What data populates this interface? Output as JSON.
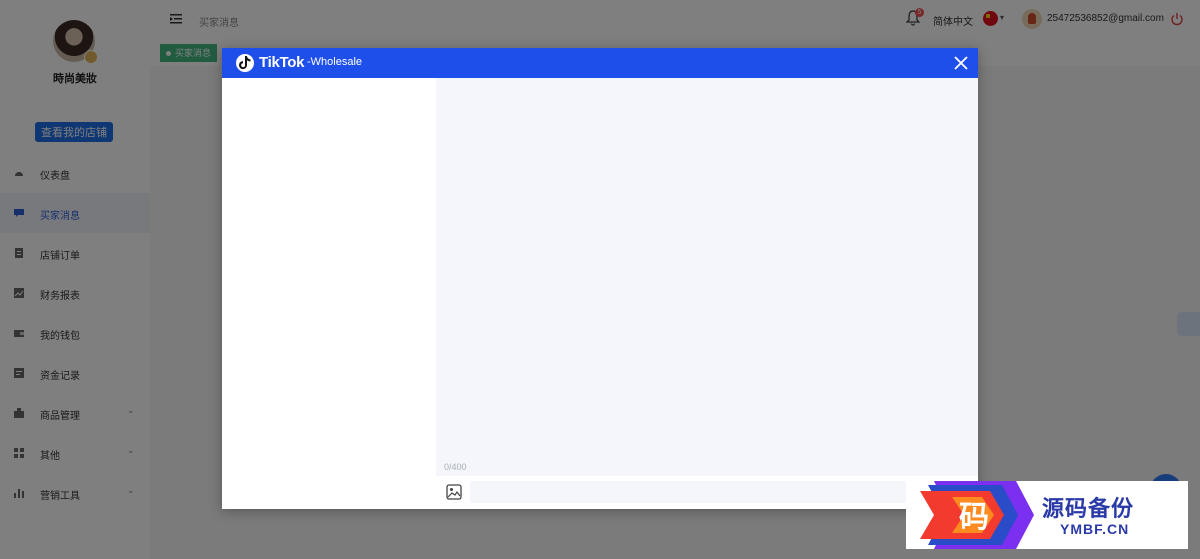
{
  "sidebar": {
    "shop_name": "時尚美妝",
    "view_store_label": "查看我的店铺",
    "items": [
      {
        "label": "仪表盘",
        "icon": "dashboard-icon",
        "active": false,
        "expandable": false
      },
      {
        "label": "买家消息",
        "icon": "message-icon",
        "active": true,
        "expandable": false
      },
      {
        "label": "店铺订单",
        "icon": "order-icon",
        "active": false,
        "expandable": false
      },
      {
        "label": "财务报表",
        "icon": "report-icon",
        "active": false,
        "expandable": false
      },
      {
        "label": "我的钱包",
        "icon": "wallet-icon",
        "active": false,
        "expandable": false
      },
      {
        "label": "资金记录",
        "icon": "record-icon",
        "active": false,
        "expandable": false
      },
      {
        "label": "商品管理",
        "icon": "goods-icon",
        "active": false,
        "expandable": true
      },
      {
        "label": "其他",
        "icon": "grid-icon",
        "active": false,
        "expandable": true
      },
      {
        "label": "营销工具",
        "icon": "chart-icon",
        "active": false,
        "expandable": true
      }
    ]
  },
  "header": {
    "breadcrumb": "买家消息",
    "notification_count": "5",
    "language": "简体中文",
    "email": "25472536852@gmail.com"
  },
  "tabs": [
    {
      "label": "买家消息",
      "active": true
    }
  ],
  "modal": {
    "brand": "TikTok",
    "suffix": "-Wholesale",
    "char_count": "0/400",
    "message_placeholder": ""
  },
  "watermark": {
    "glyph": "码",
    "cn": "源码备份",
    "en": "YMBF.CN"
  },
  "colors": {
    "header_blue": "#1e4fea",
    "tag_green": "#42b983",
    "button_blue": "#1e6fe6",
    "badge_red": "#f04d4d"
  }
}
